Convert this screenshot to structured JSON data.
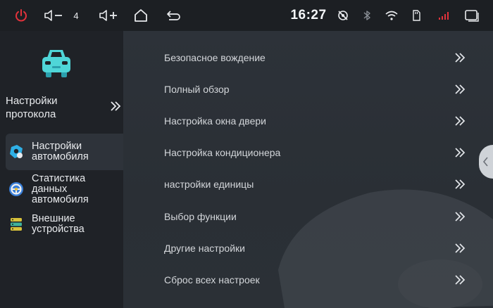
{
  "statusbar": {
    "volume_level": "4",
    "time": "16:27",
    "icons": [
      "power-icon",
      "volume-down-icon",
      "volume-up-icon",
      "home-icon",
      "back-icon",
      "no-location-icon",
      "bluetooth-icon",
      "wifi-icon",
      "sd-card-icon",
      "signal-icon",
      "recent-apps-icon"
    ],
    "colors": {
      "power": "#e2323b",
      "accent_blue": "#4a9cf0"
    }
  },
  "sidebar": {
    "car_icon": "car-icon",
    "protocol_label": "Настройки протокола",
    "items": [
      {
        "label": "Настройки автомобиля",
        "icon": "car-settings-icon",
        "active": true
      },
      {
        "label": "Статистика данных автомобиля",
        "icon": "steering-wheel-icon",
        "active": false
      },
      {
        "label": "Внешние устройства",
        "icon": "devices-icon",
        "active": false
      }
    ]
  },
  "main": {
    "items": [
      {
        "label": "Безопасное вождение"
      },
      {
        "label": "Полный обзор"
      },
      {
        "label": "Настройка окна двери"
      },
      {
        "label": "Настройка кондиционера"
      },
      {
        "label": "настройки единицы"
      },
      {
        "label": "Выбор функции"
      },
      {
        "label": "Другие настройки"
      },
      {
        "label": "Сброс всех настроек"
      }
    ]
  },
  "edge_tab": {
    "icon": "chevron-left-icon"
  }
}
